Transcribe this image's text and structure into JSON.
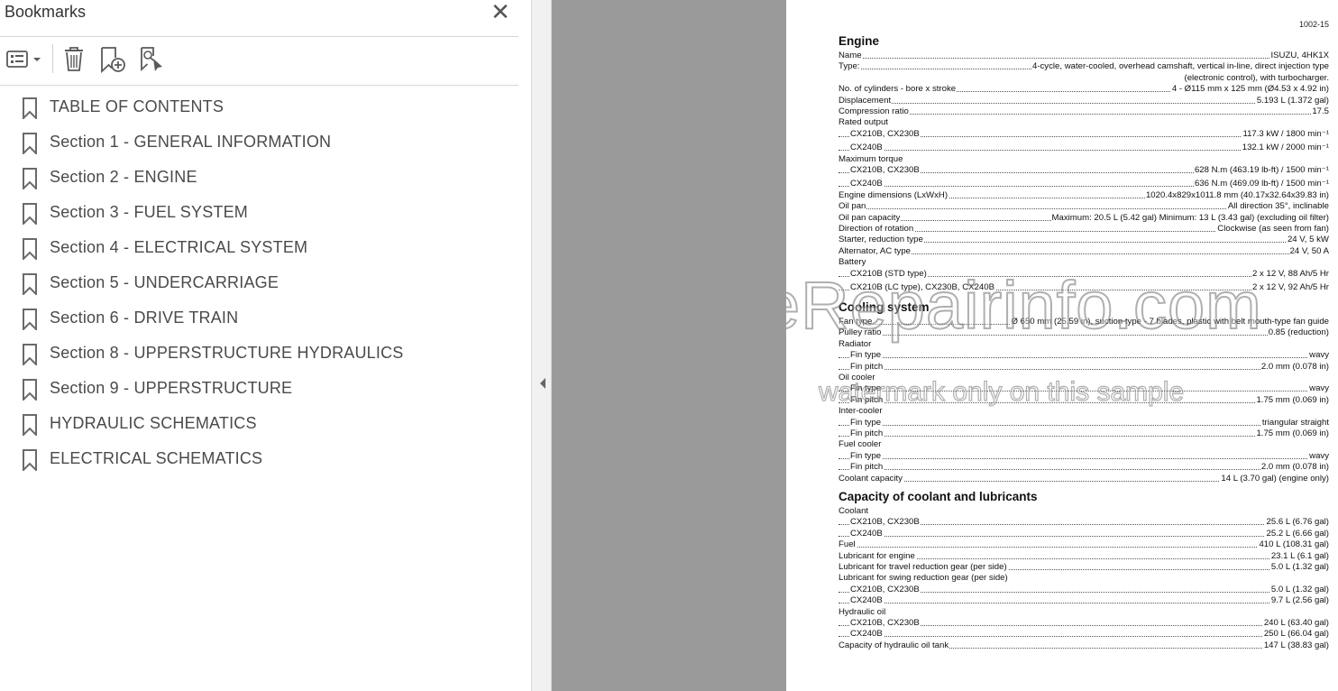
{
  "sidebar": {
    "title": "Bookmarks",
    "close_label": "✕",
    "items": [
      {
        "label": "TABLE OF CONTENTS"
      },
      {
        "label": "Section 1 - GENERAL INFORMATION"
      },
      {
        "label": "Section 2 - ENGINE"
      },
      {
        "label": "Section 3 - FUEL SYSTEM"
      },
      {
        "label": "Section 4 - ELECTRICAL SYSTEM"
      },
      {
        "label": "Section 5 - UNDERCARRIAGE"
      },
      {
        "label": "Section 6 - DRIVE TRAIN"
      },
      {
        "label": "Section 8 - UPPERSTRUCTURE HYDRAULICS"
      },
      {
        "label": "Section 9 - UPPERSTRUCTURE"
      },
      {
        "label": "HYDRAULIC SCHEMATICS"
      },
      {
        "label": "ELECTRICAL SCHEMATICS"
      }
    ]
  },
  "toolbar": {
    "icons": [
      "options-menu-icon",
      "delete-bookmark-icon",
      "new-bookmark-icon",
      "find-bookmark-icon"
    ]
  },
  "document": {
    "page_number": "1002-15",
    "engine": {
      "title": "Engine",
      "rows": [
        {
          "label": "Name",
          "value": "ISUZU, 4HK1X"
        },
        {
          "label": "Type: ",
          "value": "4-cycle, water-cooled, overhead camshaft, vertical in-line, direct injection type"
        },
        {
          "cont": "(electronic control), with turbocharger."
        },
        {
          "label": "No. of cylinders - bore x stroke",
          "value": "4 - Ø115 mm x 125 mm (Ø4.53 x 4.92 in)"
        },
        {
          "label": "Displacement",
          "value": "5.193 L (1.372 gal)"
        },
        {
          "label": "Compression ratio",
          "value": "17.5"
        },
        {
          "label": "Rated output"
        },
        {
          "label": "CX210B, CX230B",
          "value": "117.3 kW / 1800 min⁻¹",
          "indent": true
        },
        {
          "label": "CX240B",
          "value": "132.1 kW / 2000 min⁻¹",
          "indent": true
        },
        {
          "label": "Maximum torque"
        },
        {
          "label": "CX210B, CX230B",
          "value": "628 N.m (463.19 lb-ft) / 1500 min⁻¹",
          "indent": true
        },
        {
          "label": "CX240B",
          "value": "636 N.m (469.09 lb-ft) / 1500 min⁻¹",
          "indent": true
        },
        {
          "label": "Engine dimensions (LxWxH)",
          "value": "1020.4x829x1011.8 mm (40.17x32.64x39.83 in)"
        },
        {
          "label": "Oil pan",
          "value": "All direction 35°, inclinable"
        },
        {
          "label": "Oil pan capacity",
          "value": "Maximum: 20.5 L (5.42 gal) Minimum: 13 L (3.43 gal) (excluding oil filter)"
        },
        {
          "label": "Direction of rotation",
          "value": "Clockwise (as seen from fan)"
        },
        {
          "label": "Starter, reduction type",
          "value": "24 V, 5 kW"
        },
        {
          "label": "Alternator, AC type",
          "value": "24 V, 50 A"
        },
        {
          "label": "Battery"
        },
        {
          "label": "CX210B (STD type)",
          "value": "2 x 12 V, 88 Ah/5 Hr",
          "indent": true
        },
        {
          "label": "CX210B (LC type), CX230B, CX240B",
          "value": "2 x 12 V, 92 Ah/5 Hr",
          "indent": true
        }
      ]
    },
    "cooling": {
      "title": "Cooling system",
      "rows": [
        {
          "label": "Fan type",
          "value": "Ø 650 mm (25.59 in), suction type - 7 blades, plastic with belt mouth-type fan guide"
        },
        {
          "label": "Pulley ratio",
          "value": "0.85 (reduction)"
        },
        {
          "label": "Radiator"
        },
        {
          "label": "Fin type",
          "value": "wavy",
          "indent": true
        },
        {
          "label": "Fin pitch",
          "value": "2.0 mm (0.078 in)",
          "indent": true
        },
        {
          "label": "Oil cooler"
        },
        {
          "label": "Fin type",
          "value": "wavy",
          "indent": true
        },
        {
          "label": "Fin pitch",
          "value": "1.75 mm (0.069 in)",
          "indent": true
        },
        {
          "label": "Inter-cooler"
        },
        {
          "label": "Fin type",
          "value": "triangular straight",
          "indent": true
        },
        {
          "label": "Fin pitch",
          "value": "1.75 mm (0.069 in)",
          "indent": true
        },
        {
          "label": "Fuel cooler"
        },
        {
          "label": "Fin type",
          "value": "wavy",
          "indent": true
        },
        {
          "label": "Fin pitch",
          "value": "2.0 mm (0.078 in)",
          "indent": true
        },
        {
          "label": "Coolant capacity",
          "value": "14 L (3.70 gal) (engine only)"
        }
      ]
    },
    "capacity": {
      "title": "Capacity of coolant and lubricants",
      "rows": [
        {
          "label": "Coolant"
        },
        {
          "label": "CX210B, CX230B",
          "value": "25.6 L (6.76 gal)",
          "indent": true
        },
        {
          "label": "CX240B",
          "value": "25.2 L (6.66 gal)",
          "indent": true
        },
        {
          "label": "Fuel",
          "value": "410 L (108.31 gal)"
        },
        {
          "label": "Lubricant for engine",
          "value": "23.1 L (6.1 gal)"
        },
        {
          "label": "Lubricant for travel reduction gear (per side)",
          "value": "5.0 L (1.32 gal)"
        },
        {
          "label": "Lubricant for swing reduction gear (per side)"
        },
        {
          "label": "CX210B, CX230B",
          "value": "5.0 L (1.32 gal)",
          "indent": true
        },
        {
          "label": "CX240B",
          "value": "9.7 L (2.56 gal)",
          "indent": true
        },
        {
          "label": "Hydraulic oil"
        },
        {
          "label": "CX210B, CX230B",
          "value": "240 L (63.40 gal)",
          "indent": true
        },
        {
          "label": "CX240B",
          "value": "250 L (66.04 gal)",
          "indent": true
        },
        {
          "label": "Capacity of hydraulic oil tank",
          "value": "147 L (38.83 gal)"
        }
      ]
    },
    "watermark": {
      "main": "eRepairinfo.com",
      "sub": "watermark only on this sample"
    }
  }
}
